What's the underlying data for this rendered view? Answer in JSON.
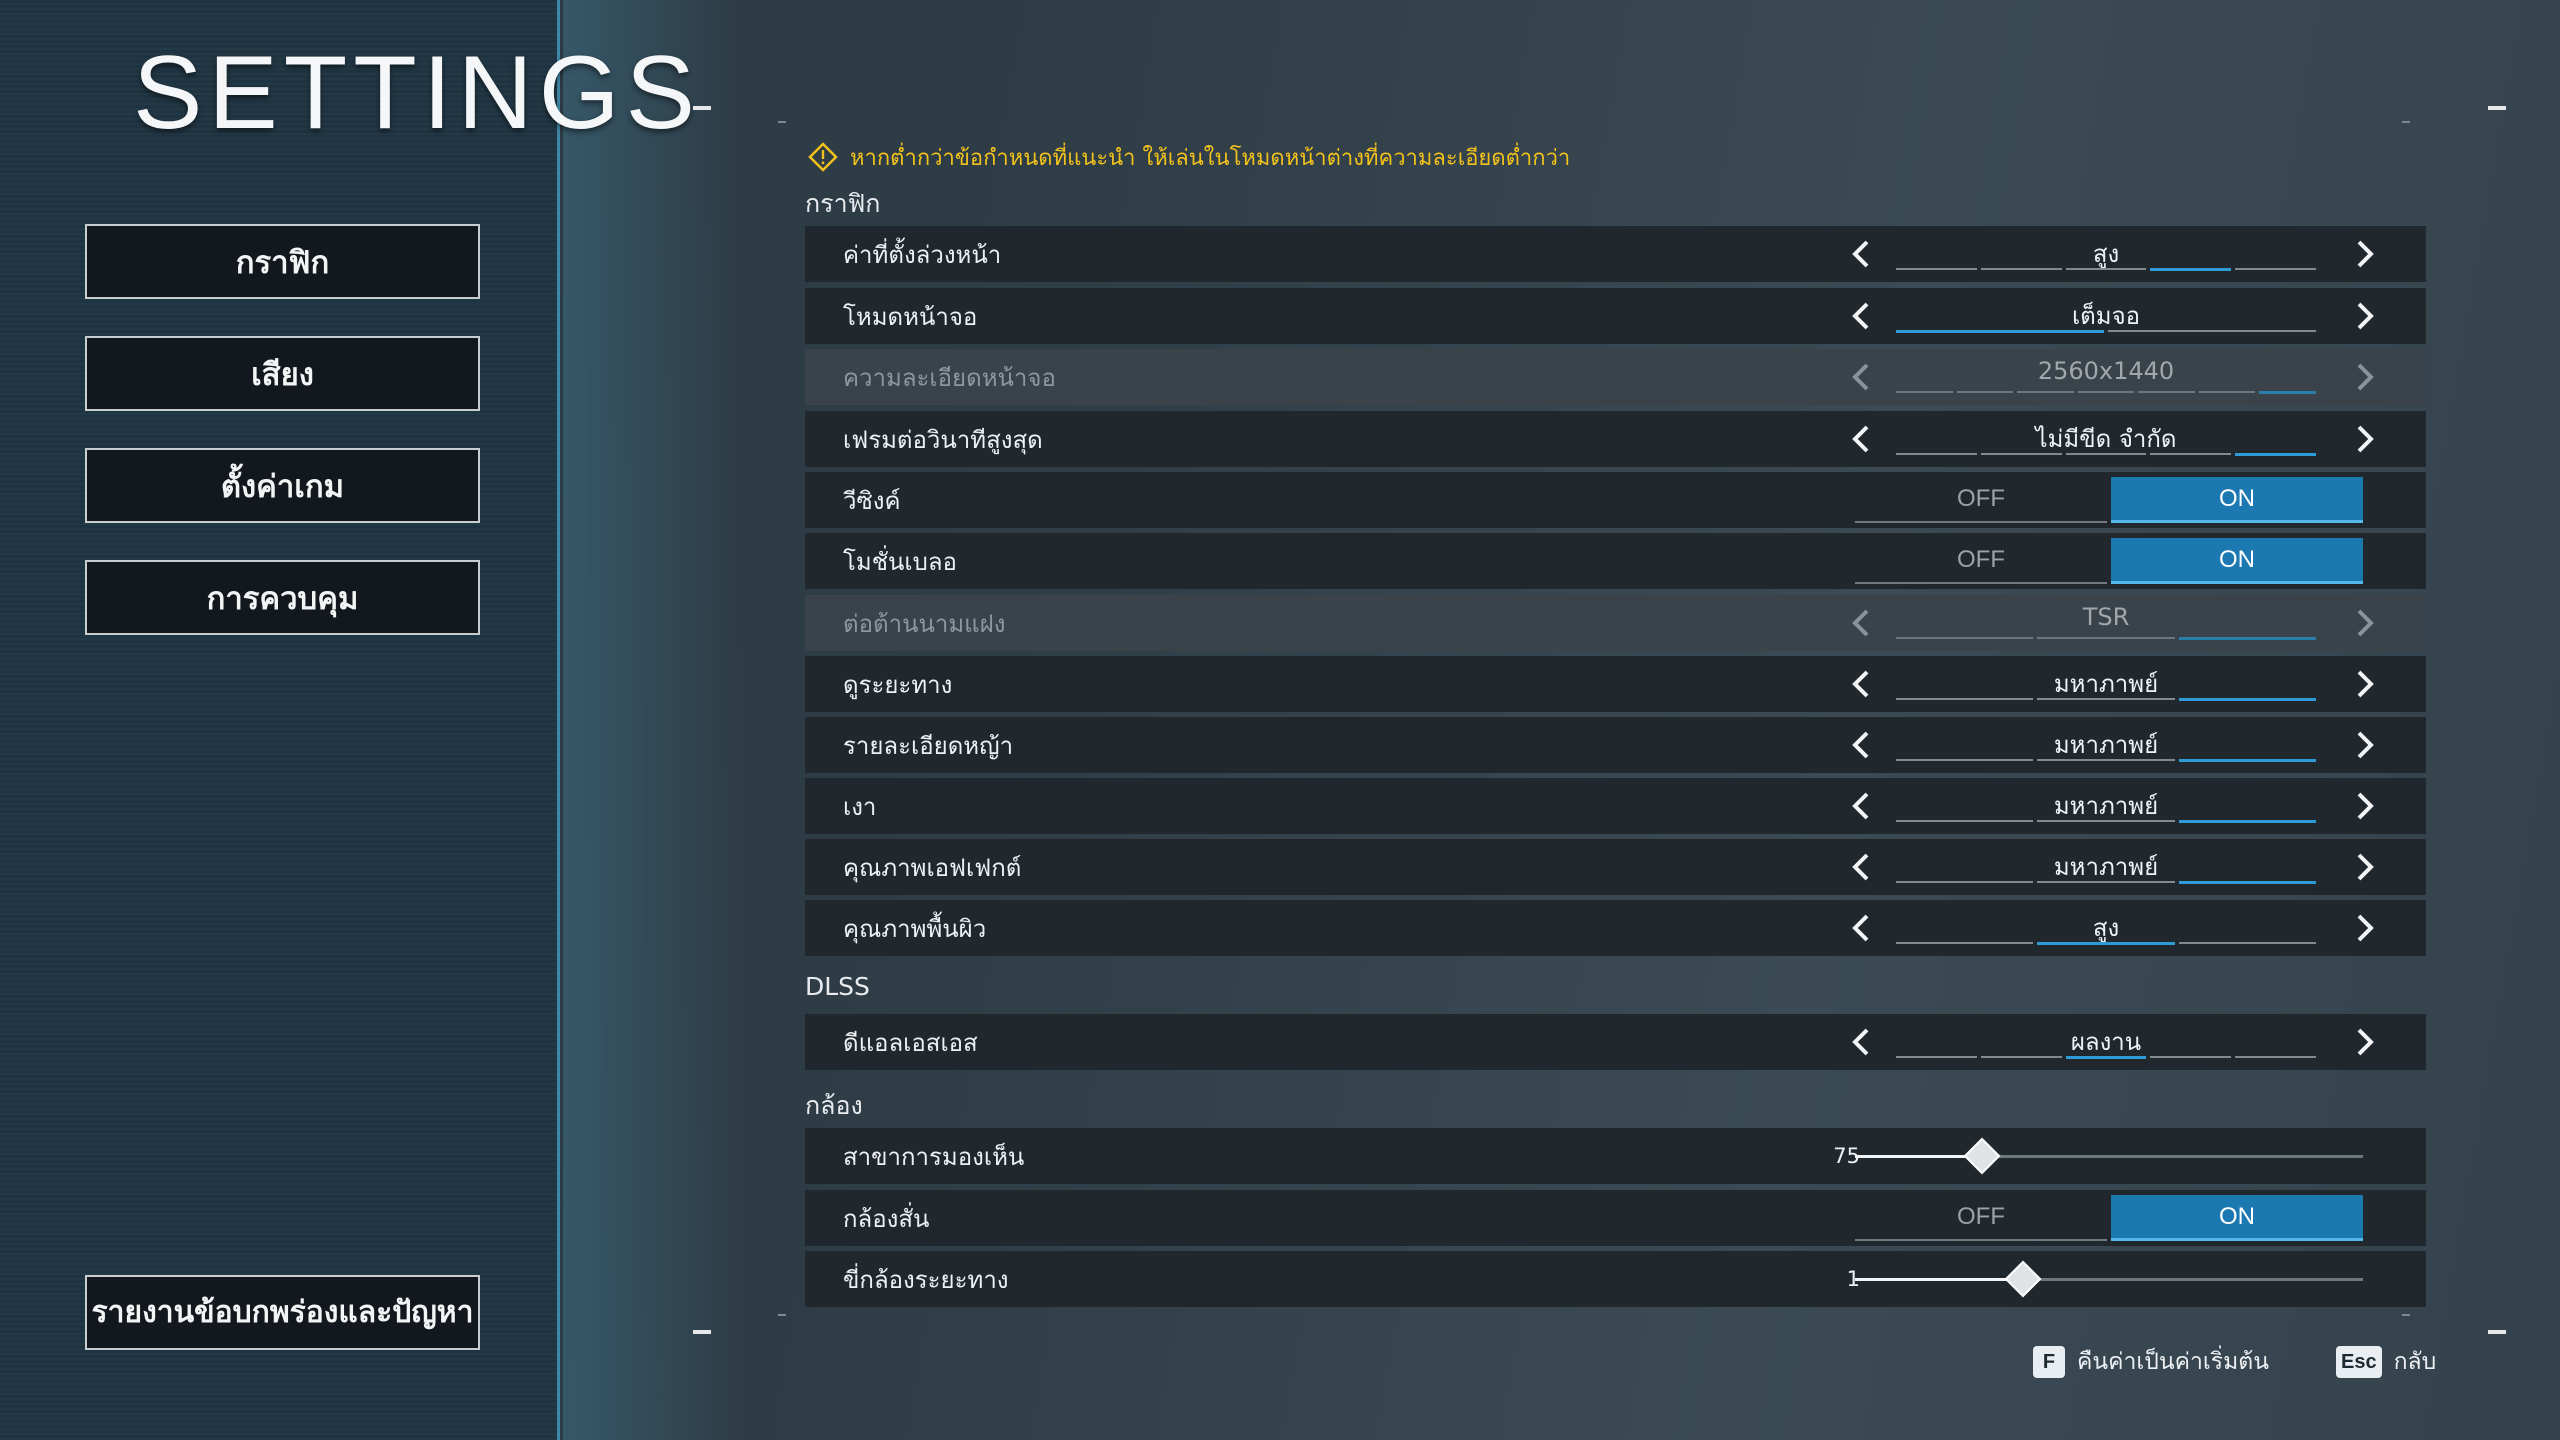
{
  "title": "SETTINGS",
  "nav": {
    "items": [
      {
        "label": "กราฟิก"
      },
      {
        "label": "เสียง"
      },
      {
        "label": "ตั้งค่าเกม"
      },
      {
        "label": "การควบคุม"
      }
    ],
    "report": "รายงานข้อบกพร่องและปัญหา"
  },
  "warning": {
    "icon": "warning-diamond-icon",
    "text": "หากต่ำกว่าข้อกำหนดที่แนะนำ ให้เล่นในโหมดหน้าต่างที่ความละเอียดต่ำกว่า",
    "color": "#f2c21a"
  },
  "sections": {
    "graphics": "กราฟิก",
    "dlss": "DLSS",
    "camera": "กล้อง"
  },
  "rows": {
    "preset": {
      "label": "ค่าที่ตั้งล่วงหน้า",
      "value": "สูง"
    },
    "display_mode": {
      "label": "โหมดหน้าจอ",
      "value": "เต็มจอ"
    },
    "resolution": {
      "label": "ความละเอียดหน้าจอ",
      "value": "2560x1440"
    },
    "max_fps": {
      "label": "เฟรมต่อวินาทีสูงสุด",
      "value": "ไม่มีขีด จำกัด"
    },
    "vsync": {
      "label": "วีซิงค์",
      "off": "OFF",
      "on": "ON"
    },
    "motion_blur": {
      "label": "โมชั่นเบลอ",
      "off": "OFF",
      "on": "ON"
    },
    "anti_aliasing": {
      "label": "ต่อต้านนามแฝง",
      "value": "TSR"
    },
    "view_distance": {
      "label": "ดูระยะทาง",
      "value": "มหาภาพย์"
    },
    "grass_detail": {
      "label": "รายละเอียดหญ้า",
      "value": "มหาภาพย์"
    },
    "shadows": {
      "label": "เงา",
      "value": "มหาภาพย์"
    },
    "effects_quality": {
      "label": "คุณภาพเอฟเฟกต์",
      "value": "มหาภาพย์"
    },
    "surface_quality": {
      "label": "คุณภาพพื้นผิว",
      "value": "สูง"
    },
    "dlss_mode": {
      "label": "ดีแอลเอสเอส",
      "value": "ผลงาน"
    },
    "fov": {
      "label": "สาขาการมองเห็น",
      "value": "75",
      "fraction": 0.25
    },
    "camera_shake": {
      "label": "กล้องสั่น",
      "off": "OFF",
      "on": "ON"
    },
    "camera_distance": {
      "label": "ขี่กล้องระยะทาง",
      "value": "1",
      "fraction": 0.33
    }
  },
  "footer": {
    "reset_key": "F",
    "reset_label": "คืนค่าเป็นค่าเริ่มต้น",
    "back_key": "Esc",
    "back_label": "กลับ"
  },
  "colors": {
    "accent": "#1b78b1",
    "segment_active": "#2f9bd6",
    "panel": "#1f3442"
  }
}
